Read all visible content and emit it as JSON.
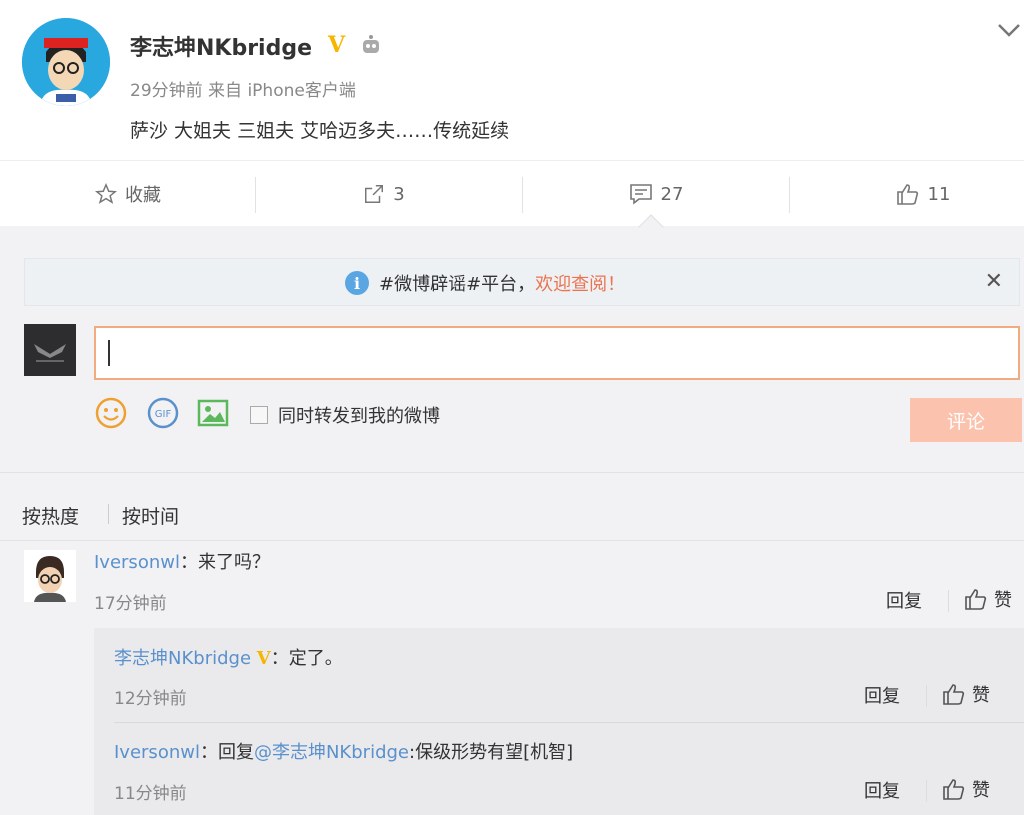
{
  "post": {
    "author": "李志坤NKbridge",
    "verified_badge": "V",
    "time": "29分钟前",
    "source": "来自 iPhone客户端",
    "text": "萨沙 大姐夫 三姐夫 艾哈迈多夫……传统延续"
  },
  "actions": {
    "favorite_label": "收藏",
    "repost_count": "3",
    "comment_count": "27",
    "like_count": "11"
  },
  "notice": {
    "prefix": "#微博辟谣#平台，",
    "link": "欢迎查阅！"
  },
  "composer": {
    "input_value": "",
    "repost_label": "同时转发到我的微博",
    "submit_label": "评论",
    "gif_label": "GIF"
  },
  "sort": {
    "hot_label": "按热度",
    "time_label": "按时间"
  },
  "comments": [
    {
      "user": "Iversonwl",
      "text": "：来了吗？",
      "time": "17分钟前",
      "reply_label": "回复",
      "like_label": "赞"
    }
  ],
  "replies": [
    {
      "user": "李志坤NKbridge",
      "badge": "V",
      "text": "：定了。",
      "time": "12分钟前",
      "reply_label": "回复",
      "like_label": "赞"
    },
    {
      "user": "Iversonwl",
      "prefix": "：回复",
      "mention": "@李志坤NKbridge",
      "text": ":保级形势有望[机智]",
      "time": "11分钟前",
      "reply_label": "回复",
      "like_label": "赞"
    }
  ],
  "colors": {
    "accent": "#eb7350",
    "link": "#5a91cc",
    "verified": "#f7b500",
    "submit_disabled": "#fbc3ad"
  }
}
